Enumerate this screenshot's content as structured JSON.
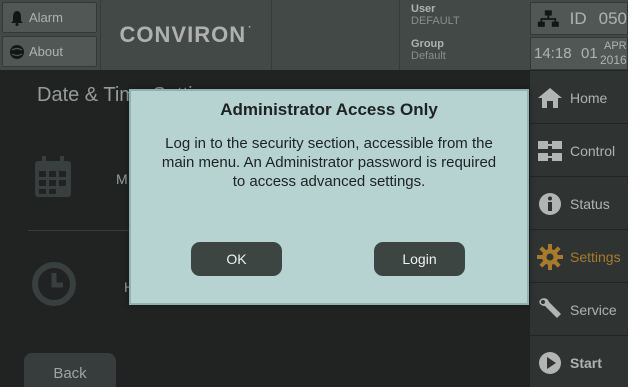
{
  "topbar": {
    "alarm_label": "Alarm",
    "about_label": "About",
    "logo": "CONVIRON",
    "logo_mark": "·",
    "user_heading": "User",
    "user_value": "DEFAULT",
    "group_heading": "Group",
    "group_value": "Default",
    "id_label": "ID",
    "id_value": "050",
    "time": "14:18",
    "day": "01",
    "month": "APR",
    "year": "2016"
  },
  "sidebar": {
    "items": [
      {
        "label": "Home",
        "icon": "home-icon"
      },
      {
        "label": "Control",
        "icon": "control-icon"
      },
      {
        "label": "Status",
        "icon": "info-icon"
      },
      {
        "label": "Settings",
        "icon": "gear-icon"
      },
      {
        "label": "Service",
        "icon": "wrench-icon"
      },
      {
        "label": "Start",
        "icon": "play-icon"
      }
    ],
    "active": "Settings"
  },
  "page": {
    "title": "Date & Time Settings",
    "row1_label": "M",
    "row2_label": "H",
    "back_label": "Back"
  },
  "modal": {
    "title": "Administrator Access Only",
    "message": "Log in to the security section, accessible from the main menu. An Administrator password is required to access advanced settings.",
    "ok_label": "OK",
    "login_label": "Login"
  },
  "colors": {
    "accent_active": "#e0a33a",
    "modal_bg": "#b6d3d1",
    "background": "#2b2f2e"
  }
}
